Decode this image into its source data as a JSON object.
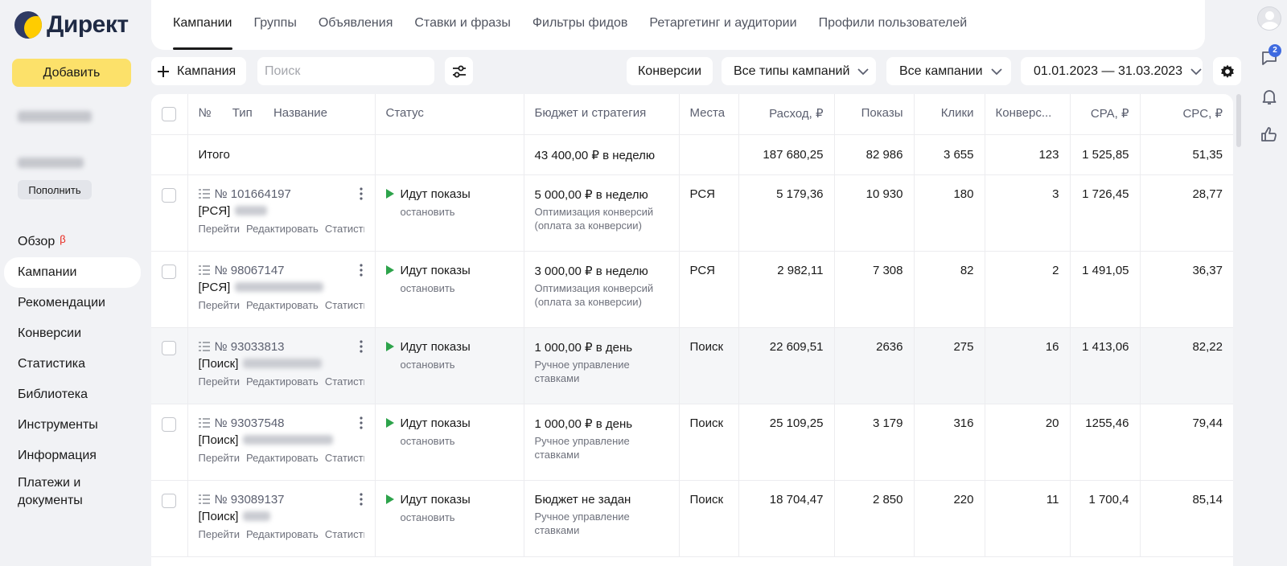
{
  "brand": {
    "logo_text": "Директ"
  },
  "sidebar": {
    "add_label": "Добавить",
    "topup_label": "Пополнить",
    "nav": [
      {
        "label": "Обзор",
        "beta": "β"
      },
      {
        "label": "Кампании",
        "active": true
      },
      {
        "label": "Рекомендации"
      },
      {
        "label": "Конверсии"
      },
      {
        "label": "Статистика"
      },
      {
        "label": "Библиотека"
      },
      {
        "label": "Инструменты"
      },
      {
        "label": "Информация"
      },
      {
        "label": "Платежи и документы"
      }
    ]
  },
  "tabs": [
    "Кампании",
    "Группы",
    "Объявления",
    "Ставки и фразы",
    "Фильтры фидов",
    "Ретаргетинг и аудитории",
    "Профили пользователей"
  ],
  "toolbar": {
    "campaign_button": "Кампания",
    "search_placeholder": "Поиск",
    "conversions_button": "Конверсии",
    "types_filter": "Все типы кампаний",
    "campaigns_filter": "Все кампании",
    "date_range": "01.01.2023 — 31.03.2023"
  },
  "notifications": {
    "messages_badge": "2"
  },
  "table": {
    "headers": {
      "num": "№",
      "type": "Тип",
      "name": "Название",
      "status": "Статус",
      "budget": "Бюджет и стратегия",
      "places": "Места",
      "spend": "Расход, ₽",
      "impressions": "Показы",
      "clicks": "Клики",
      "conversions": "Конверс...",
      "cpa": "CPA, ₽",
      "cpc": "CPC, ₽"
    },
    "total": {
      "label": "Итого",
      "budget": "43 400,00 ₽ в неделю",
      "spend": "187 680,25",
      "impressions": "82 986",
      "clicks": "3 655",
      "conversions": "123",
      "cpa": "1 525,85",
      "cpc": "51,35"
    },
    "link_labels": {
      "go": "Перейти",
      "edit": "Редактировать",
      "stats": "Статистика"
    },
    "rows": [
      {
        "id": "№ 101664197",
        "type": "[РСЯ]",
        "status": "Идут показы",
        "stop": "остановить",
        "budget": "5 000,00 ₽ в неделю",
        "strategy": "Оптимизация конверсий (оплата за конверсии)",
        "places": "РСЯ",
        "spend": "5 179,36",
        "impressions": "10 930",
        "clicks": "180",
        "conversions": "3",
        "cpa": "1 726,45",
        "cpc": "28,77"
      },
      {
        "id": "№ 98067147",
        "type": "[РСЯ]",
        "status": "Идут показы",
        "stop": "остановить",
        "budget": "3 000,00 ₽ в неделю",
        "strategy": "Оптимизация конверсий (оплата за конверсии)",
        "places": "РСЯ",
        "spend": "2 982,11",
        "impressions": "7 308",
        "clicks": "82",
        "conversions": "2",
        "cpa": "1 491,05",
        "cpc": "36,37"
      },
      {
        "id": "№ 93033813",
        "type": "[Поиск]",
        "status": "Идут показы",
        "stop": "остановить",
        "budget": "1 000,00 ₽ в день",
        "strategy": "Ручное управление ставками",
        "places": "Поиск",
        "spend": "22 609,51",
        "impressions": "2636",
        "clicks": "275",
        "conversions": "16",
        "cpa": "1 413,06",
        "cpc": "82,22"
      },
      {
        "id": "№ 93037548",
        "type": "[Поиск]",
        "status": "Идут показы",
        "stop": "остановить",
        "budget": "1 000,00 ₽ в день",
        "strategy": "Ручное управление ставками",
        "places": "Поиск",
        "spend": "25 109,25",
        "impressions": "3 179",
        "clicks": "316",
        "conversions": "20",
        "cpa": "1255,46",
        "cpc": "79,44"
      },
      {
        "id": "№ 93089137",
        "type": "[Поиск]",
        "status": "Идут показы",
        "stop": "остановить",
        "budget": "Бюджет не задан",
        "strategy": "Ручное управление ставками",
        "places": "Поиск",
        "spend": "18 704,47",
        "impressions": "2 850",
        "clicks": "220",
        "conversions": "11",
        "cpa": "1 700,4",
        "cpc": "85,14"
      }
    ]
  },
  "colors": {
    "accent_yellow": "#fce16a",
    "play_green": "#2da34b",
    "badge_blue": "#3f6be0",
    "beta_red": "#e8261c"
  }
}
